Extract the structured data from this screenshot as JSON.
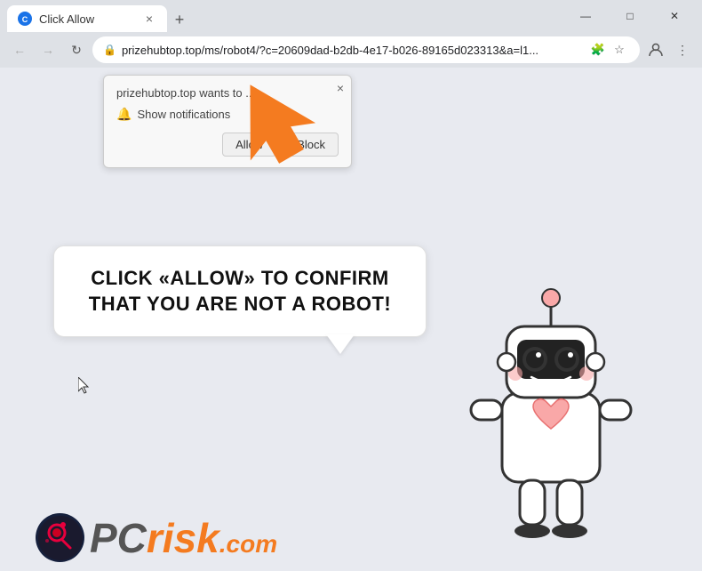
{
  "browser": {
    "tab": {
      "favicon": "C",
      "title": "Click Allow",
      "close": "×"
    },
    "new_tab_btn": "+",
    "window_controls": {
      "minimize": "—",
      "maximize": "□",
      "close": "✕"
    },
    "nav": {
      "back": "←",
      "forward": "→",
      "refresh": "↻",
      "lock_icon": "🔒",
      "address": "prizehubtop.top/ms/robot4/?c=20609dad-b2db-4e17-b026-89165d023313&a=l1...",
      "bookmark": "☆",
      "profile": "👤",
      "menu": "⋮",
      "extensions": "🧩"
    }
  },
  "notification_popup": {
    "title": "prizehubtop.top wants to ...",
    "show_notifications": "Show notifications",
    "allow": "Allow",
    "block": "Block",
    "close": "×"
  },
  "speech_bubble": {
    "text": "CLICK «ALLOW» TO CONFIRM THAT YOU ARE NOT A ROBOT!"
  },
  "pcrisk": {
    "pc": "PC",
    "risk": "risk",
    "domain": ".com"
  }
}
